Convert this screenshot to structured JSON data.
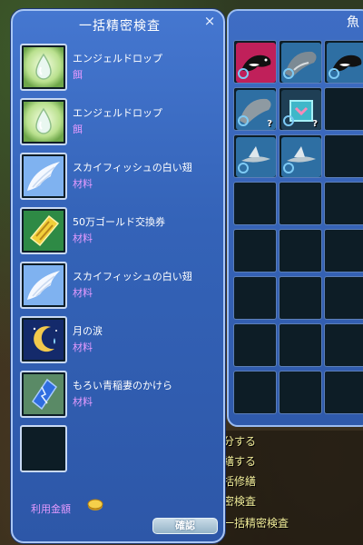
{
  "dialog": {
    "title": "一括精密検査",
    "close_label": "×",
    "items": [
      {
        "name": "エンジェルドロップ",
        "type": "餌",
        "icon": "angel-drop-icon"
      },
      {
        "name": "エンジェルドロップ",
        "type": "餌",
        "icon": "angel-drop-icon"
      },
      {
        "name": "スカイフィッシュの白い翅",
        "type": "材料",
        "icon": "white-wing-icon"
      },
      {
        "name": "50万ゴールド交換券",
        "type": "材料",
        "icon": "gold-ticket-icon"
      },
      {
        "name": "スカイフィッシュの白い翅",
        "type": "材料",
        "icon": "white-wing-icon"
      },
      {
        "name": "月の涙",
        "type": "材料",
        "icon": "moon-tear-icon"
      },
      {
        "name": "もろい青稲妻のかけら",
        "type": "材料",
        "icon": "blue-lightning-shard-icon"
      }
    ],
    "cost_label": "利用金額",
    "confirm_label": "確認"
  },
  "inventory_panel": {
    "title": "魚"
  },
  "world_menu": {
    "items": [
      "分する",
      "繕する",
      "括修繕",
      "密検査",
      "一括精密検査"
    ]
  },
  "colors": {
    "dialog_bg": "#3463b8",
    "border": "#a9c6f5",
    "type_text": "#e59bff",
    "menu_text": "#f3ee9a"
  }
}
